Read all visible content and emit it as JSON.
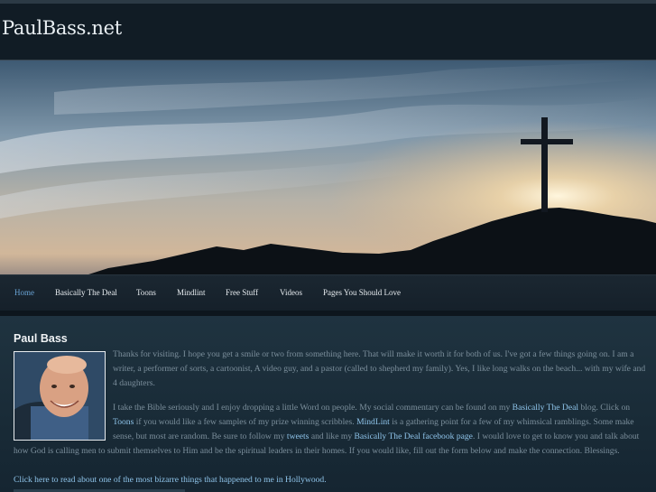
{
  "site": {
    "title": "PaulBass.net"
  },
  "nav": {
    "items": [
      {
        "label": "Home",
        "active": true
      },
      {
        "label": "Basically The Deal",
        "active": false
      },
      {
        "label": "Toons",
        "active": false
      },
      {
        "label": "Mindlint",
        "active": false
      },
      {
        "label": "Free Stuff",
        "active": false
      },
      {
        "label": "Videos",
        "active": false
      },
      {
        "label": "Pages You Should Love",
        "active": false
      }
    ]
  },
  "content": {
    "heading": "Paul Bass",
    "p1": "Thanks for visiting. I hope you get a smile or two from something here. That will make it worth it for both of us.  I've got a few things going on. I am a writer, a performer of sorts, a cartoonist, A video guy, and a pastor (called to shepherd my family). Yes, I like long walks on the beach... with my wife and 4 daughters.",
    "p2_a": "I take the Bible seriously and I enjoy dropping a little Word on people. My social commentary can be found on my ",
    "p2_link1": "Basically The Deal",
    "p2_b": " blog. Click on ",
    "p2_link2": "Toons",
    "p2_c": " if you would like a few samples of my prize winning scribbles. ",
    "p2_link3": "MindLint",
    "p2_d": " is a gathering point for a few of my whimsical ramblings. Some make sense, but most are random. Be sure to follow my ",
    "p2_link4": "tweets",
    "p2_e": " and like my ",
    "p2_link5": "Basically The Deal facebook page",
    "p2_f": ". I would love to get to know you and talk about how God is calling men to submit themselves to Him and be the spiritual leaders in their homes. If you would like, fill out the form below and make the connection. Blessings.",
    "bottom_link": "Click here to read about one of the most bizarre things that happened to me in Hollywood."
  }
}
